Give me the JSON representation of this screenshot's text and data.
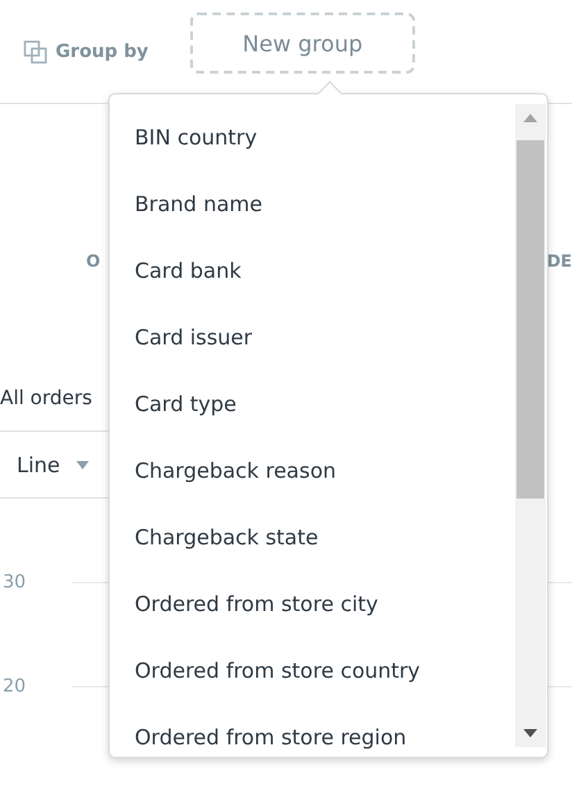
{
  "toolbar": {
    "group_by_label": "Group by",
    "new_group_button": "New group"
  },
  "background": {
    "column_headers": [
      "O",
      "DE"
    ],
    "panel_title": "All orders",
    "chart_type_select": "Line",
    "y_axis_labels": [
      "30",
      "20"
    ]
  },
  "dropdown": {
    "items": [
      {
        "label": "BIN country"
      },
      {
        "label": "Brand name"
      },
      {
        "label": "Card bank"
      },
      {
        "label": "Card issuer"
      },
      {
        "label": "Card type"
      },
      {
        "label": "Chargeback reason"
      },
      {
        "label": "Chargeback state"
      },
      {
        "label": "Ordered from store city"
      },
      {
        "label": "Ordered from store country"
      },
      {
        "label": "Ordered from store region"
      }
    ]
  }
}
